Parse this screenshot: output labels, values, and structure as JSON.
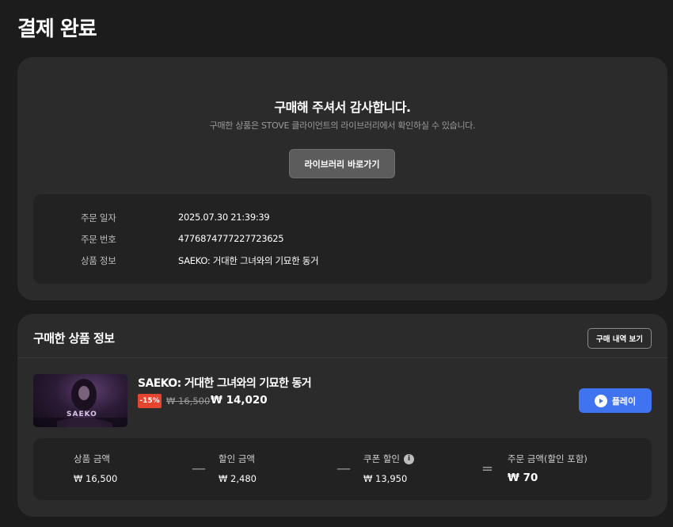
{
  "page": {
    "title": "결제 완료"
  },
  "complete": {
    "heading": "구매해 주셔서 감사합니다.",
    "subtext": "구매한 상품은 STOVE 클라이언트의 라이브러리에서 확인하실 수 있습니다.",
    "library_button": "라이브러리 바로가기"
  },
  "order": {
    "rows": [
      {
        "label": "주문 일자",
        "value": "2025.07.30 21:39:39"
      },
      {
        "label": "주문 번호",
        "value": "4776874777227723625"
      },
      {
        "label": "상품 정보",
        "value": "SAEKO: 거대한 그녀와의 기묘한 동거"
      }
    ]
  },
  "products": {
    "heading": "구매한 상품 정보",
    "history_button": "구매 내역 보기",
    "item": {
      "name": "SAEKO: 거대한 그녀와의 기묘한 동거",
      "thumbnail_text": "SAEKO",
      "discount_badge": "-15%",
      "original_price": "₩ 16,500",
      "sale_price": "₩ 14,020",
      "play_button": "플레이",
      "play_icon": "play-circle-icon"
    },
    "summary": {
      "items": [
        {
          "label": "상품 금액",
          "value": "₩ 16,500"
        },
        {
          "label": "할인 금액",
          "value": "₩ 2,480"
        },
        {
          "label": "쿠폰 할인",
          "value": "₩ 13,950",
          "icon": "info-icon"
        },
        {
          "label": "주문 금액(할인 포함)",
          "value": "₩ 70"
        }
      ],
      "operators": [
        "—",
        "—",
        "="
      ]
    }
  },
  "colors": {
    "background": "#1c1c1c",
    "card": "#2b2b2b",
    "accent": "#3f73f0",
    "discount": "#e5452f"
  }
}
